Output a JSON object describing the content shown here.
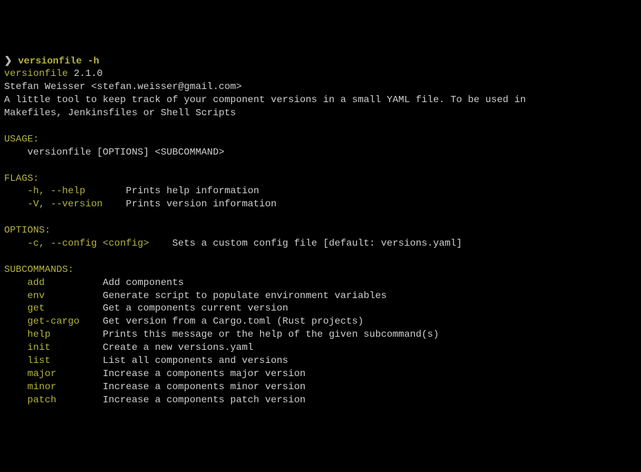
{
  "prompt": {
    "symbol": "❯",
    "command": "versionfile -h"
  },
  "header": {
    "program": "versionfile",
    "version": " 2.1.0",
    "author": "Stefan Weisser <stefan.weisser@gmail.com>",
    "description": "A little tool to keep track of your component versions in a small YAML file. To be used in\nMakefiles, Jenkinsfiles or Shell Scripts"
  },
  "usage": {
    "heading": "USAGE:",
    "text": "versionfile [OPTIONS] <SUBCOMMAND>"
  },
  "flags": {
    "heading": "FLAGS:",
    "items": [
      {
        "flag": "-h, --help",
        "spacer": "       ",
        "desc": "Prints help information"
      },
      {
        "flag": "-V, --version",
        "spacer": "    ",
        "desc": "Prints version information"
      }
    ]
  },
  "options": {
    "heading": "OPTIONS:",
    "items": [
      {
        "flag": "-c, --config <config>",
        "spacer": "    ",
        "desc": "Sets a custom config file [default: versions.yaml]"
      }
    ]
  },
  "subcommands": {
    "heading": "SUBCOMMANDS:",
    "items": [
      {
        "name": "add",
        "spacer": "          ",
        "desc": "Add components"
      },
      {
        "name": "env",
        "spacer": "          ",
        "desc": "Generate script to populate environment variables"
      },
      {
        "name": "get",
        "spacer": "          ",
        "desc": "Get a components current version"
      },
      {
        "name": "get-cargo",
        "spacer": "    ",
        "desc": "Get version from a Cargo.toml (Rust projects)"
      },
      {
        "name": "help",
        "spacer": "         ",
        "desc": "Prints this message or the help of the given subcommand(s)"
      },
      {
        "name": "init",
        "spacer": "         ",
        "desc": "Create a new versions.yaml"
      },
      {
        "name": "list",
        "spacer": "         ",
        "desc": "List all components and versions"
      },
      {
        "name": "major",
        "spacer": "        ",
        "desc": "Increase a components major version"
      },
      {
        "name": "minor",
        "spacer": "        ",
        "desc": "Increase a components minor version"
      },
      {
        "name": "patch",
        "spacer": "        ",
        "desc": "Increase a components patch version"
      }
    ]
  }
}
